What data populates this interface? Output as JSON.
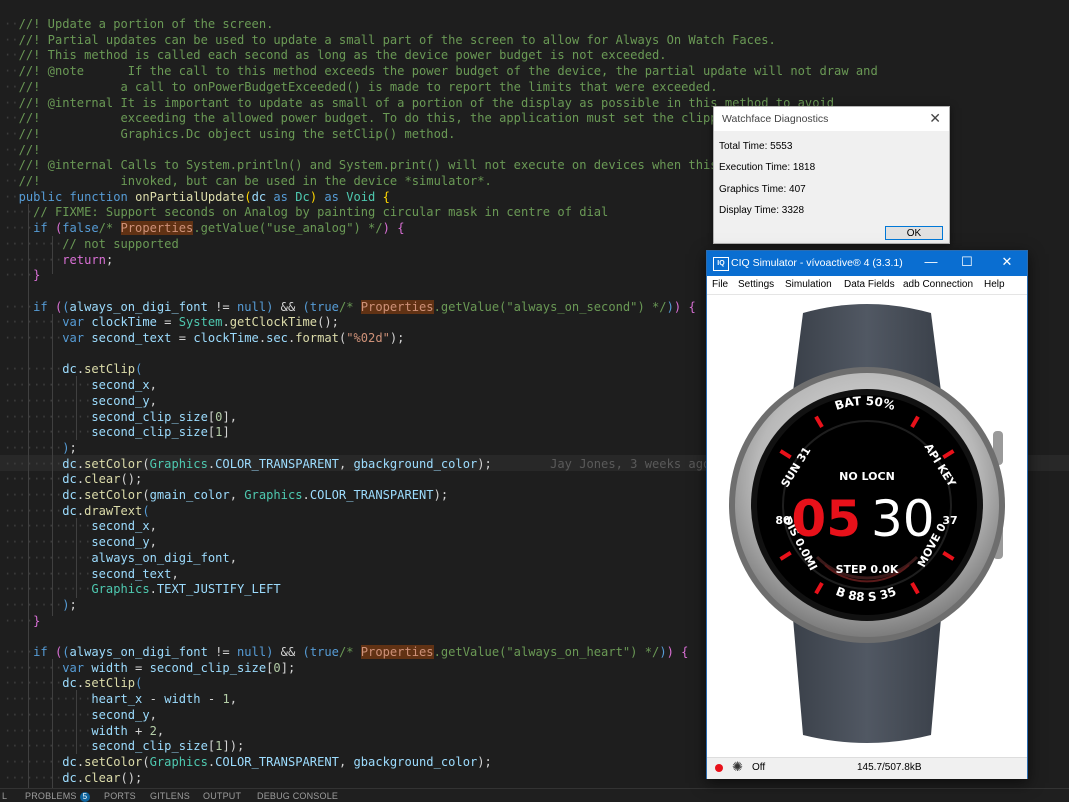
{
  "editor": {
    "lines": [
      [
        [
          "ws",
          "··"
        ],
        [
          "c",
          "//! Update a portion of the screen."
        ]
      ],
      [
        [
          "ws",
          "··"
        ],
        [
          "c",
          "//! Partial updates can be used to update a small part of the screen to allow for Always On Watch Faces."
        ]
      ],
      [
        [
          "ws",
          "··"
        ],
        [
          "c",
          "//! This method is called each second as long as the device power budget is not exceeded."
        ]
      ],
      [
        [
          "ws",
          "··"
        ],
        [
          "c",
          "//! @note      If the call to this method exceeds the power budget of the device, the partial update will not draw and"
        ]
      ],
      [
        [
          "ws",
          "··"
        ],
        [
          "c",
          "//!           a call to onPowerBudgetExceeded() is made to report the limits that were exceeded."
        ]
      ],
      [
        [
          "ws",
          "··"
        ],
        [
          "c",
          "//! @internal It is important to update as small of a portion of the display as possible in this method to avoid"
        ]
      ],
      [
        [
          "ws",
          "··"
        ],
        [
          "c",
          "//!           exceeding the allowed power budget. To do this, the application must set the clipping"
        ]
      ],
      [
        [
          "ws",
          "··"
        ],
        [
          "c",
          "//!           Graphics.Dc object using the setClip() method."
        ]
      ],
      [
        [
          "ws",
          "··"
        ],
        [
          "c",
          "//!"
        ]
      ],
      [
        [
          "ws",
          "··"
        ],
        [
          "c",
          "//! @internal Calls to System.println() and System.print() will not execute on devices when this"
        ]
      ],
      [
        [
          "ws",
          "··"
        ],
        [
          "c",
          "//!           invoked, but can be used in the device *simulator*."
        ]
      ],
      [
        [
          "ws",
          "··"
        ],
        [
          "kw",
          "public"
        ],
        [
          "op",
          " "
        ],
        [
          "kw",
          "function"
        ],
        [
          "op",
          " "
        ],
        [
          "fn",
          "onPartialUpdate"
        ],
        [
          "pb",
          "("
        ],
        [
          "vr",
          "dc"
        ],
        [
          "op",
          " "
        ],
        [
          "kw",
          "as"
        ],
        [
          "op",
          " "
        ],
        [
          "tp",
          "Dc"
        ],
        [
          "pb",
          ")"
        ],
        [
          "op",
          " "
        ],
        [
          "kw",
          "as"
        ],
        [
          "op",
          " "
        ],
        [
          "tp",
          "Void"
        ],
        [
          "op",
          " "
        ],
        [
          "pb",
          "{"
        ]
      ],
      [
        [
          "ws",
          "····"
        ],
        [
          "c",
          "// FIXME: Support seconds on Analog by painting circular mask in centre of dial"
        ]
      ],
      [
        [
          "ws",
          "····"
        ],
        [
          "kw",
          "if"
        ],
        [
          "op",
          " "
        ],
        [
          "pp",
          "("
        ],
        [
          "kw",
          "false"
        ],
        [
          "c",
          "/* "
        ],
        [
          "hl",
          "Properties"
        ],
        [
          "c",
          ".getValue(\"use_analog\") */"
        ],
        [
          "pp",
          ")"
        ],
        [
          "op",
          " "
        ],
        [
          "pp",
          "{"
        ]
      ],
      [
        [
          "ws",
          "········"
        ],
        [
          "c",
          "// not supported"
        ]
      ],
      [
        [
          "ws",
          "········"
        ],
        [
          "pp",
          "return"
        ],
        [
          "op",
          ";"
        ]
      ],
      [
        [
          "ws",
          "····"
        ],
        [
          "pp",
          "}"
        ]
      ],
      [],
      [
        [
          "ws",
          "····"
        ],
        [
          "kw",
          "if"
        ],
        [
          "op",
          " "
        ],
        [
          "pp",
          "("
        ],
        [
          "kw",
          "("
        ],
        [
          "vr",
          "always_on_digi_font"
        ],
        [
          "op",
          " != "
        ],
        [
          "kw",
          "null"
        ],
        [
          "kw",
          ")"
        ],
        [
          "op",
          " && "
        ],
        [
          "kw",
          "("
        ],
        [
          "kw",
          "true"
        ],
        [
          "c",
          "/* "
        ],
        [
          "hl",
          "Properties"
        ],
        [
          "c",
          ".getValue(\"always_on_second\") */"
        ],
        [
          "kw",
          ")"
        ],
        [
          "pp",
          ")"
        ],
        [
          "op",
          " "
        ],
        [
          "pp",
          "{"
        ]
      ],
      [
        [
          "ws",
          "········"
        ],
        [
          "kw",
          "var"
        ],
        [
          "op",
          " "
        ],
        [
          "vr",
          "clockTime"
        ],
        [
          "op",
          " = "
        ],
        [
          "tp",
          "System"
        ],
        [
          "op",
          "."
        ],
        [
          "fn",
          "getClockTime"
        ],
        [
          "op",
          "();"
        ]
      ],
      [
        [
          "ws",
          "········"
        ],
        [
          "kw",
          "var"
        ],
        [
          "op",
          " "
        ],
        [
          "vr",
          "second_text"
        ],
        [
          "op",
          " = "
        ],
        [
          "vr",
          "clockTime"
        ],
        [
          "op",
          "."
        ],
        [
          "vr",
          "sec"
        ],
        [
          "op",
          "."
        ],
        [
          "fn",
          "format"
        ],
        [
          "op",
          "("
        ],
        [
          "st",
          "\"%02d\""
        ],
        [
          "op",
          ");"
        ]
      ],
      [],
      [
        [
          "ws",
          "········"
        ],
        [
          "vr",
          "dc"
        ],
        [
          "op",
          "."
        ],
        [
          "fn",
          "setClip"
        ],
        [
          "kw",
          "("
        ]
      ],
      [
        [
          "ws",
          "············"
        ],
        [
          "vr",
          "second_x"
        ],
        [
          "op",
          ","
        ]
      ],
      [
        [
          "ws",
          "············"
        ],
        [
          "vr",
          "second_y"
        ],
        [
          "op",
          ","
        ]
      ],
      [
        [
          "ws",
          "············"
        ],
        [
          "vr",
          "second_clip_size"
        ],
        [
          "op",
          "["
        ],
        [
          "nm",
          "0"
        ],
        [
          "op",
          "],"
        ]
      ],
      [
        [
          "ws",
          "············"
        ],
        [
          "vr",
          "second_clip_size"
        ],
        [
          "op",
          "["
        ],
        [
          "nm",
          "1"
        ],
        [
          "op",
          "]"
        ]
      ],
      [
        [
          "ws",
          "········"
        ],
        [
          "kw",
          ")"
        ],
        [
          "op",
          ";"
        ]
      ],
      [
        [
          "ws",
          "········"
        ],
        [
          "vr",
          "dc"
        ],
        [
          "op",
          "."
        ],
        [
          "fn",
          "setColor"
        ],
        [
          "op",
          "("
        ],
        [
          "tp",
          "Graphics"
        ],
        [
          "op",
          "."
        ],
        [
          "vr",
          "COLOR_TRANSPARENT"
        ],
        [
          "op",
          ", "
        ],
        [
          "vr",
          "gbackground_color"
        ],
        [
          "op",
          ");"
        ],
        [
          "blame",
          "        Jay Jones, 3 weeks ago •"
        ]
      ],
      [
        [
          "ws",
          "········"
        ],
        [
          "vr",
          "dc"
        ],
        [
          "op",
          "."
        ],
        [
          "fn",
          "clear"
        ],
        [
          "op",
          "();"
        ]
      ],
      [
        [
          "ws",
          "········"
        ],
        [
          "vr",
          "dc"
        ],
        [
          "op",
          "."
        ],
        [
          "fn",
          "setColor"
        ],
        [
          "op",
          "("
        ],
        [
          "vr",
          "gmain_color"
        ],
        [
          "op",
          ", "
        ],
        [
          "tp",
          "Graphics"
        ],
        [
          "op",
          "."
        ],
        [
          "vr",
          "COLOR_TRANSPARENT"
        ],
        [
          "op",
          ");"
        ]
      ],
      [
        [
          "ws",
          "········"
        ],
        [
          "vr",
          "dc"
        ],
        [
          "op",
          "."
        ],
        [
          "fn",
          "drawText"
        ],
        [
          "kw",
          "("
        ]
      ],
      [
        [
          "ws",
          "············"
        ],
        [
          "vr",
          "second_x"
        ],
        [
          "op",
          ","
        ]
      ],
      [
        [
          "ws",
          "············"
        ],
        [
          "vr",
          "second_y"
        ],
        [
          "op",
          ","
        ]
      ],
      [
        [
          "ws",
          "············"
        ],
        [
          "vr",
          "always_on_digi_font"
        ],
        [
          "op",
          ","
        ]
      ],
      [
        [
          "ws",
          "············"
        ],
        [
          "vr",
          "second_text"
        ],
        [
          "op",
          ","
        ]
      ],
      [
        [
          "ws",
          "············"
        ],
        [
          "tp",
          "Graphics"
        ],
        [
          "op",
          "."
        ],
        [
          "vr",
          "TEXT_JUSTIFY_LEFT"
        ]
      ],
      [
        [
          "ws",
          "········"
        ],
        [
          "kw",
          ")"
        ],
        [
          "op",
          ";"
        ]
      ],
      [
        [
          "ws",
          "····"
        ],
        [
          "pp",
          "}"
        ]
      ],
      [],
      [
        [
          "ws",
          "····"
        ],
        [
          "kw",
          "if"
        ],
        [
          "op",
          " "
        ],
        [
          "pp",
          "("
        ],
        [
          "kw",
          "("
        ],
        [
          "vr",
          "always_on_digi_font"
        ],
        [
          "op",
          " != "
        ],
        [
          "kw",
          "null"
        ],
        [
          "kw",
          ")"
        ],
        [
          "op",
          " && "
        ],
        [
          "kw",
          "("
        ],
        [
          "kw",
          "true"
        ],
        [
          "c",
          "/* "
        ],
        [
          "hl",
          "Properties"
        ],
        [
          "c",
          ".getValue(\"always_on_heart\") */"
        ],
        [
          "kw",
          ")"
        ],
        [
          "pp",
          ")"
        ],
        [
          "op",
          " "
        ],
        [
          "pp",
          "{"
        ]
      ],
      [
        [
          "ws",
          "········"
        ],
        [
          "kw",
          "var"
        ],
        [
          "op",
          " "
        ],
        [
          "vr",
          "width"
        ],
        [
          "op",
          " = "
        ],
        [
          "vr",
          "second_clip_size"
        ],
        [
          "op",
          "["
        ],
        [
          "nm",
          "0"
        ],
        [
          "op",
          "];"
        ]
      ],
      [
        [
          "ws",
          "········"
        ],
        [
          "vr",
          "dc"
        ],
        [
          "op",
          "."
        ],
        [
          "fn",
          "setClip"
        ],
        [
          "kw",
          "("
        ]
      ],
      [
        [
          "ws",
          "············"
        ],
        [
          "vr",
          "heart_x"
        ],
        [
          "op",
          " - "
        ],
        [
          "vr",
          "width"
        ],
        [
          "op",
          " - "
        ],
        [
          "nm",
          "1"
        ],
        [
          "op",
          ","
        ]
      ],
      [
        [
          "ws",
          "············"
        ],
        [
          "vr",
          "second_y"
        ],
        [
          "op",
          ","
        ]
      ],
      [
        [
          "ws",
          "············"
        ],
        [
          "vr",
          "width"
        ],
        [
          "op",
          " + "
        ],
        [
          "nm",
          "2"
        ],
        [
          "op",
          ","
        ]
      ],
      [
        [
          "ws",
          "············"
        ],
        [
          "vr",
          "second_clip_size"
        ],
        [
          "op",
          "["
        ],
        [
          "nm",
          "1"
        ],
        [
          "op",
          "]);"
        ]
      ],
      [
        [
          "ws",
          "········"
        ],
        [
          "vr",
          "dc"
        ],
        [
          "op",
          "."
        ],
        [
          "fn",
          "setColor"
        ],
        [
          "op",
          "("
        ],
        [
          "tp",
          "Graphics"
        ],
        [
          "op",
          "."
        ],
        [
          "vr",
          "COLOR_TRANSPARENT"
        ],
        [
          "op",
          ", "
        ],
        [
          "vr",
          "gbackground_color"
        ],
        [
          "op",
          ");"
        ]
      ],
      [
        [
          "ws",
          "········"
        ],
        [
          "vr",
          "dc"
        ],
        [
          "op",
          "."
        ],
        [
          "fn",
          "clear"
        ],
        [
          "op",
          "();"
        ]
      ]
    ]
  },
  "panel_tabs": {
    "left_fragment": "L",
    "problems": "PROBLEMS",
    "problems_count": "5",
    "ports": "PORTS",
    "gitlens": "GITLENS",
    "output": "OUTPUT",
    "debug_console": "DEBUG CONSOLE"
  },
  "diagnostics": {
    "title": "Watchface Diagnostics",
    "rows": [
      "Total Time: 5553",
      "Execution Time: 1818",
      "Graphics Time: 407",
      "Display Time: 3328"
    ],
    "ok_label": "OK"
  },
  "simulator": {
    "icon_label": "IQ",
    "title": "CIQ Simulator - vívoactive® 4 (3.3.1)",
    "menu": [
      "File",
      "Settings",
      "Simulation",
      "Data Fields",
      "adb Connection",
      "Help"
    ],
    "status_off": "Off",
    "memory": "145.7/507.8kB",
    "watchface": {
      "battery": "BAT 50%",
      "location": "NO LOCN",
      "hour": "05",
      "minute": "30",
      "left_value": "80",
      "right_value": "37",
      "steps": "STEP 0.0K",
      "sun": "SUN 31",
      "api": "API KEY",
      "distance": "DIS 0.0MI",
      "move": "MOVE 0",
      "bottom": "B 88 S 35"
    }
  },
  "colors": {
    "accent_red": "#e8111a",
    "window_blue": "#0a6ed1",
    "editor_bg": "#1e1e1e"
  }
}
